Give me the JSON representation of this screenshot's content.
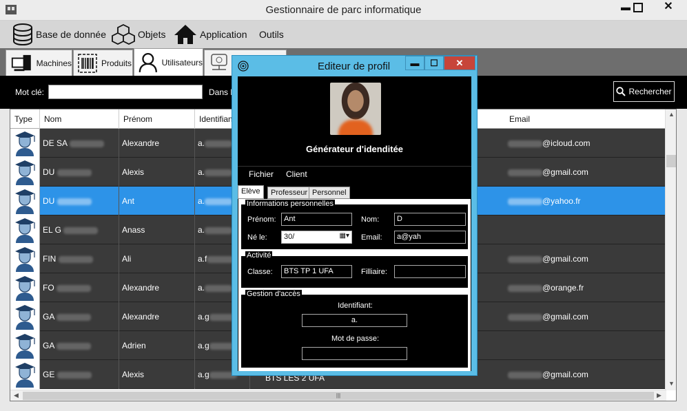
{
  "window": {
    "title": "Gestionnaire de parc informatique",
    "min": "▬",
    "max": "☐",
    "close": "✕"
  },
  "menu": [
    {
      "label": "Base de donnée",
      "icon": "database-icon"
    },
    {
      "label": "Objets",
      "icon": "cubes-icon"
    },
    {
      "label": "Application",
      "icon": "home-icon"
    },
    {
      "label": "Outils",
      "icon": ""
    }
  ],
  "tabs": [
    {
      "label": "Machines",
      "icon": "computer-icon"
    },
    {
      "label": "Produits",
      "icon": "barcode-icon"
    },
    {
      "label": "Utilisateurs",
      "icon": "user-icon"
    },
    {
      "label": "",
      "icon": "network-icon"
    }
  ],
  "search": {
    "label": "Mot clé:",
    "value": "",
    "dans_label": "Dans la",
    "button": "Rechercher"
  },
  "grid": {
    "columns": [
      "Type",
      "Nom",
      "Prénom",
      "Identifiant",
      "Email"
    ],
    "rows": [
      {
        "nom": "DE SA",
        "prenom": "Alexandre",
        "ident": "a.",
        "email": "@icloud.com",
        "selected": false
      },
      {
        "nom": "DU",
        "prenom": "Alexis",
        "ident": "a.",
        "email": "@gmail.com",
        "selected": false
      },
      {
        "nom": "DU",
        "prenom": "Ant",
        "ident": "a.",
        "email": "@yahoo.fr",
        "selected": true
      },
      {
        "nom": "EL G",
        "prenom": "Anass",
        "ident": "a.",
        "email": "",
        "selected": false
      },
      {
        "nom": "FIN",
        "prenom": "Ali",
        "ident": "a.f",
        "email": "@gmail.com",
        "selected": false
      },
      {
        "nom": "FO",
        "prenom": "Alexandre",
        "ident": "a.",
        "email": "@orange.fr",
        "selected": false
      },
      {
        "nom": "GA",
        "prenom": "Alexandre",
        "ident": "a.g",
        "email": "@gmail.com",
        "selected": false
      },
      {
        "nom": "GA",
        "prenom": "Adrien",
        "ident": "a.g",
        "email": "",
        "selected": false
      },
      {
        "nom": "GE",
        "prenom": "Alexis",
        "ident": "a.g",
        "email": "@gmail.com",
        "selected": false
      }
    ],
    "bottom_row_extra": "BTS LES 2 UFA"
  },
  "dialog": {
    "title": "Editeur de profil",
    "heading": "Générateur d'idenditée",
    "menu": [
      "Fichier",
      "Client"
    ],
    "tabs": [
      "Elève",
      "Professeur",
      "Personnel"
    ],
    "group_personal": "Informations personnelles",
    "prenom_label": "Prénom:",
    "prenom_value": "Ant",
    "nom_label": "Nom:",
    "nom_value": "D",
    "ne_label": "Né le:",
    "ne_value": "30/",
    "email_label": "Email:",
    "email_value": "a@yah",
    "group_activity": "Activité",
    "classe_label": "Classe:",
    "classe_value": "BTS TP 1 UFA",
    "filiere_label": "Filliaire:",
    "filiere_value": "",
    "group_access": "Gestion d'accès",
    "ident_label": "Identifiant:",
    "ident_value": "a.",
    "pwd_label": "Mot de passe:",
    "pwd_value": ""
  }
}
